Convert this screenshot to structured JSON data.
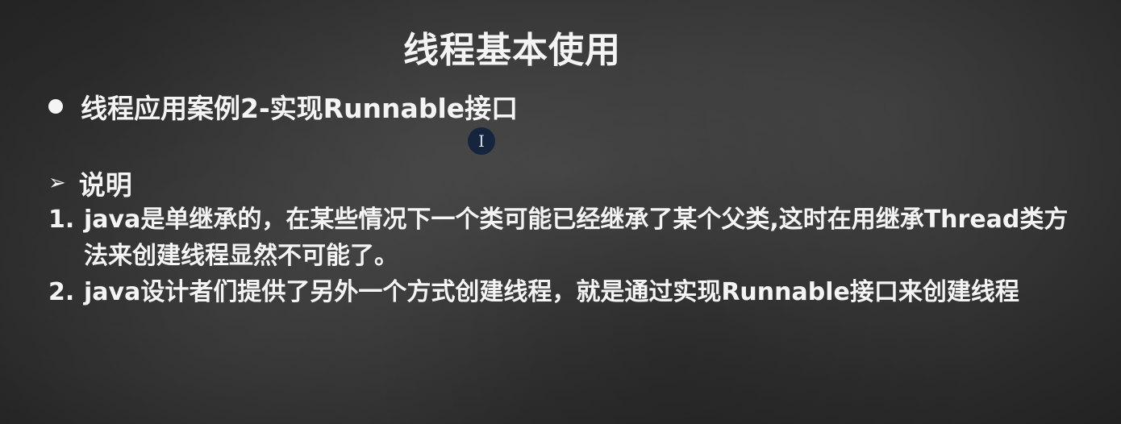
{
  "slide": {
    "title": "线程基本使用",
    "bullet_text": "线程应用案例2-实现Runnable接口",
    "cursor_glyph": "I",
    "section_heading": "说明",
    "section_icon": "arrow-icon",
    "items": [
      {
        "number": "1.",
        "text": "java是单继承的，在某些情况下一个类可能已经继承了某个父类,这时在用继承Thread类方法来创建线程显然不可能了。"
      },
      {
        "number": "2.",
        "text": "java设计者们提供了另外一个方式创建线程，就是通过实现Runnable接口来创建线程"
      }
    ]
  }
}
